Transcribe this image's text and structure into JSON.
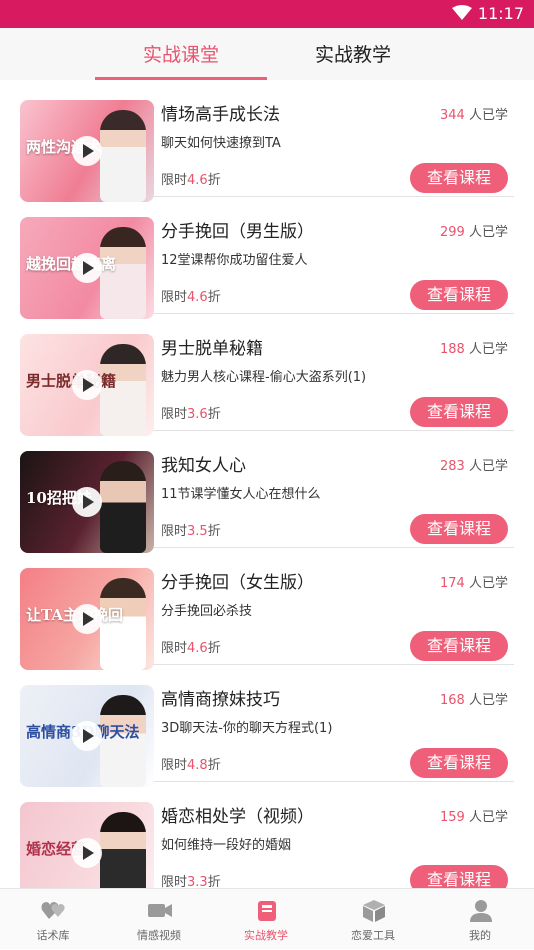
{
  "status_bar": {
    "time": "11:17"
  },
  "tabs": [
    {
      "label": "实战课堂",
      "active": true
    },
    {
      "label": "实战教学",
      "active": false
    }
  ],
  "courses": [
    {
      "title": "情场高手成长法",
      "subtitle": "聊天如何快速撩到TA",
      "learners": "344",
      "learners_suffix": "人已学",
      "discount_prefix": "限时",
      "discount": "4.6",
      "discount_suffix": "折",
      "button": "查看课程",
      "thumb_text": "两性沟通术"
    },
    {
      "title": "分手挽回（男生版）",
      "subtitle": "12堂课帮你成功留住爱人",
      "learners": "299",
      "learners_suffix": "人已学",
      "discount_prefix": "限时",
      "discount": "4.6",
      "discount_suffix": "折",
      "button": "查看课程",
      "thumb_text": "越挽回越离离"
    },
    {
      "title": "男士脱单秘籍",
      "subtitle": "魅力男人核心课程-偷心大盗系列(1)",
      "learners": "188",
      "learners_suffix": "人已学",
      "discount_prefix": "限时",
      "discount": "3.6",
      "discount_suffix": "折",
      "button": "查看课程",
      "thumb_text": "男士脱单秘籍"
    },
    {
      "title": "我知女人心",
      "subtitle": "11节课学懂女人心在想什么",
      "learners": "283",
      "learners_suffix": "人已学",
      "discount_prefix": "限时",
      "discount": "3.5",
      "discount_suffix": "折",
      "button": "查看课程",
      "thumb_text": "10招把妹"
    },
    {
      "title": "分手挽回（女生版）",
      "subtitle": "分手挽回必杀技",
      "learners": "174",
      "learners_suffix": "人已学",
      "discount_prefix": "限时",
      "discount": "4.6",
      "discount_suffix": "折",
      "button": "查看课程",
      "thumb_text": "让TA主动挽回"
    },
    {
      "title": "高情商撩妹技巧",
      "subtitle": "3D聊天法-你的聊天方程式(1)",
      "learners": "168",
      "learners_suffix": "人已学",
      "discount_prefix": "限时",
      "discount": "4.8",
      "discount_suffix": "折",
      "button": "查看课程",
      "thumb_text": "高情商3D聊天法"
    },
    {
      "title": "婚恋相处学（视频）",
      "subtitle": "如何维持一段好的婚姻",
      "learners": "159",
      "learners_suffix": "人已学",
      "discount_prefix": "限时",
      "discount": "3.3",
      "discount_suffix": "折",
      "button": "查看课程",
      "thumb_text": "婚恋经营"
    }
  ],
  "bottom_nav": [
    {
      "label": "话术库",
      "icon": "hearts-icon",
      "active": false
    },
    {
      "label": "情感视频",
      "icon": "video-camera-icon",
      "active": false
    },
    {
      "label": "实战教学",
      "icon": "book-icon",
      "active": true
    },
    {
      "label": "恋爱工具",
      "icon": "box-icon",
      "active": false
    },
    {
      "label": "我的",
      "icon": "user-icon",
      "active": false
    }
  ],
  "colors": {
    "status_bar": "#d81b60",
    "accent": "#ef5f79",
    "accent_text": "#e8546d"
  }
}
